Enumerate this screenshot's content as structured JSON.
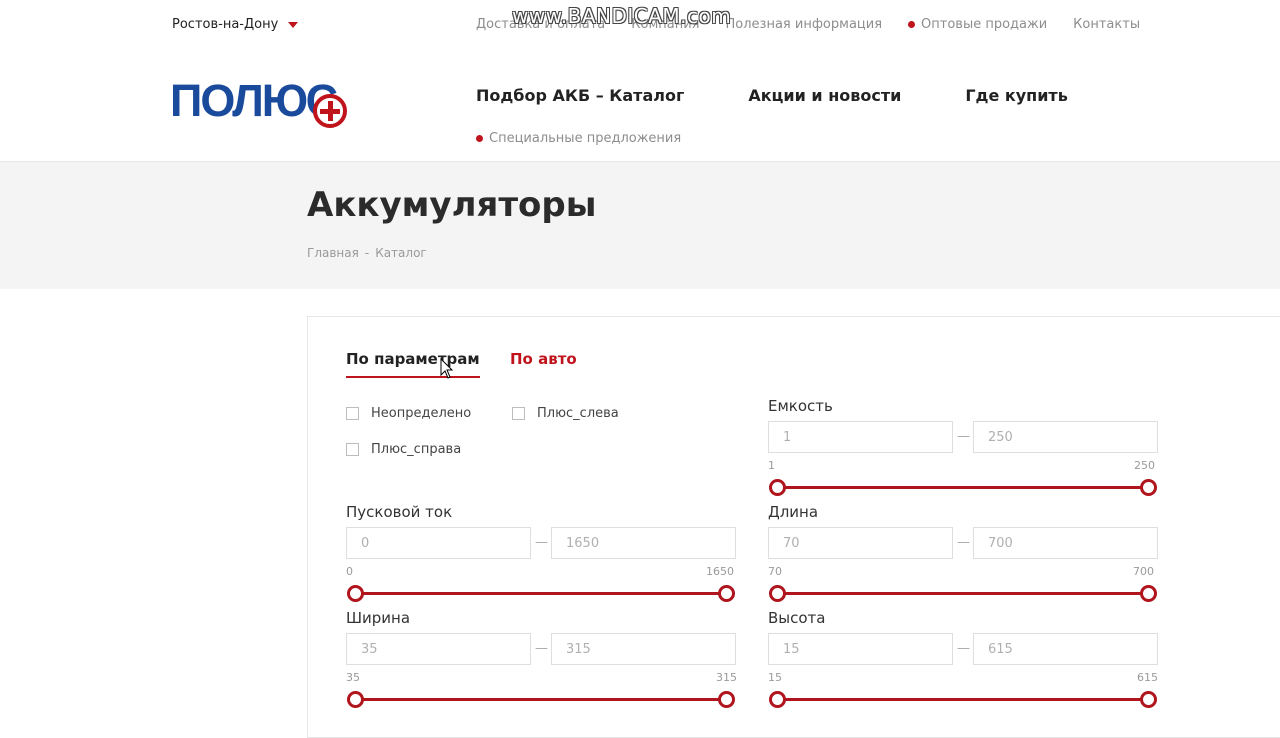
{
  "topbar": {
    "city": "Ростов-на-Дону",
    "links": [
      "Доставка и оплата",
      "Компания",
      "Полезная информация",
      "Оптовые продажи",
      "Контакты"
    ],
    "watermark": "www.BANDICAM.com"
  },
  "logo": {
    "text": "ПОЛЮС"
  },
  "mainnav": {
    "items": [
      "Подбор АКБ – Каталог",
      "Акции и новости",
      "Где купить"
    ],
    "special": "Специальные предложения"
  },
  "hero": {
    "title": "Аккумуляторы",
    "breadcrumb": [
      "Главная",
      "Каталог"
    ]
  },
  "filter": {
    "tabs": {
      "active": "По параметрам",
      "other": "По авто"
    },
    "checkboxes": [
      "Неопределено",
      "Плюс_слева",
      "Плюс_справа"
    ],
    "ranges": {
      "capacity": {
        "label": "Емкость",
        "from": "1",
        "to": "250",
        "min": "1",
        "max": "250"
      },
      "current": {
        "label": "Пусковой ток",
        "from": "0",
        "to": "1650",
        "min": "0",
        "max": "1650"
      },
      "length": {
        "label": "Длина",
        "from": "70",
        "to": "700",
        "min": "70",
        "max": "700"
      },
      "width": {
        "label": "Ширина",
        "from": "35",
        "to": "315",
        "min": "35",
        "max": "315"
      },
      "height": {
        "label": "Высота",
        "from": "15",
        "to": "615",
        "min": "15",
        "max": "615"
      }
    }
  },
  "colors": {
    "accent": "#c0141c",
    "brand_blue": "#1a4a9c"
  }
}
